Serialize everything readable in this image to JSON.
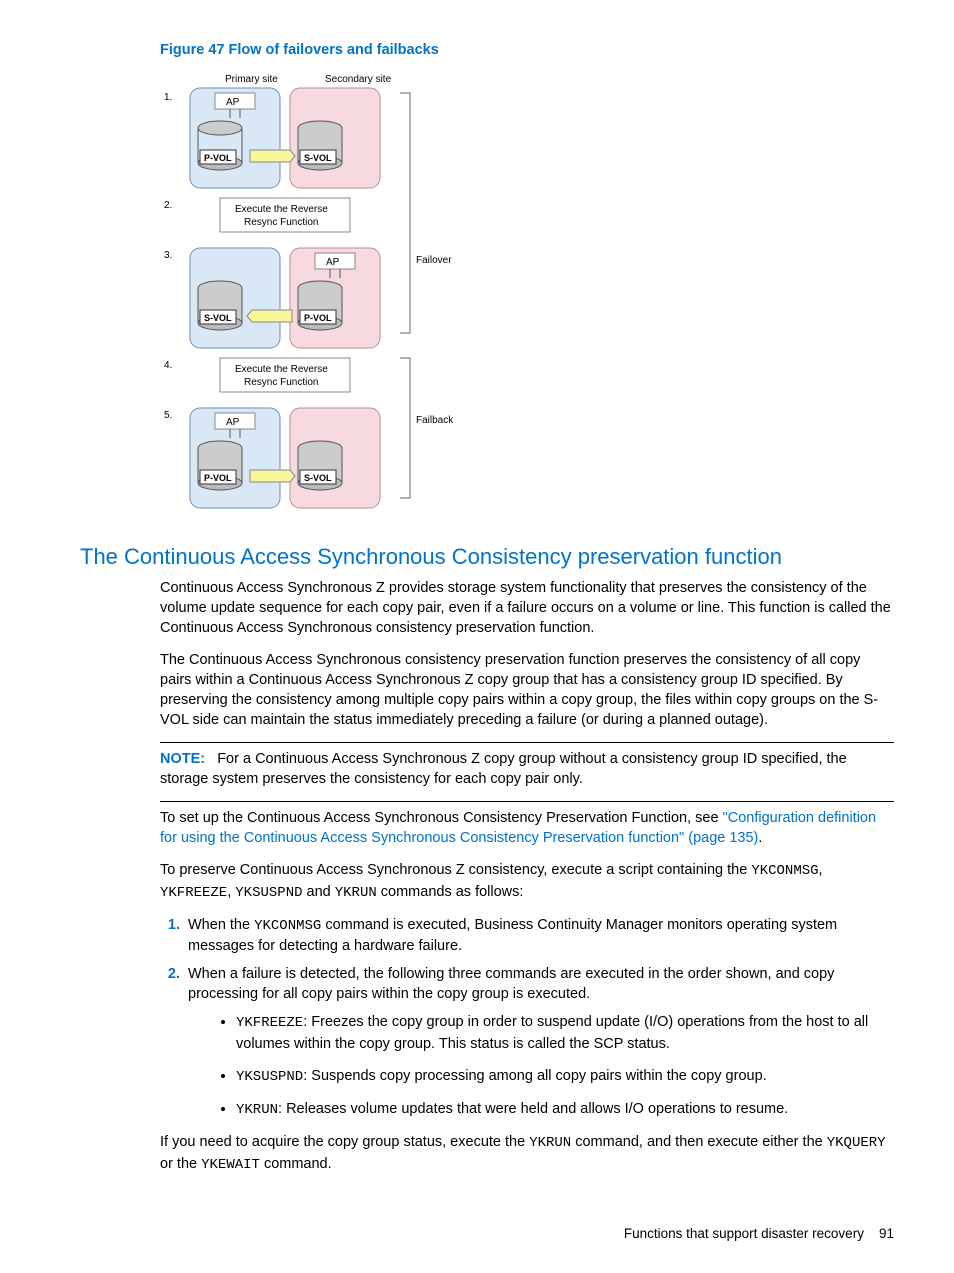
{
  "figure": {
    "caption": "Figure 47 Flow of failovers and failbacks",
    "primary_label": "Primary site",
    "secondary_label": "Secondary site",
    "ap": "AP",
    "pvol": "P-VOL",
    "svol": "S-VOL",
    "reverse_resync": "Execute the Reverse Resync Function",
    "failover": "Failover",
    "failback": "Failback",
    "steps": [
      "1.",
      "2.",
      "3.",
      "4.",
      "5."
    ]
  },
  "section_heading": "The Continuous Access Synchronous Consistency preservation function",
  "para1": "Continuous Access Synchronous Z provides storage system functionality that preserves the consistency of the volume update sequence for each copy pair, even if a failure occurs on a volume or line. This function is called the Continuous Access Synchronous consistency preservation function.",
  "para2": "The Continuous Access Synchronous consistency preservation function preserves the consistency of all copy pairs within a Continuous Access Synchronous Z copy group that has a consistency group ID specified. By preserving the consistency among multiple copy pairs within a copy group, the files within copy groups on the S-VOL side can maintain the status immediately preceding a failure (or during a planned outage).",
  "note": {
    "label": "NOTE:",
    "text": "For a Continuous Access Synchronous Z copy group without a consistency group ID specified, the storage system preserves the consistency for each copy pair only."
  },
  "para3_a": "To set up the Continuous Access Synchronous Consistency Preservation Function, see ",
  "para3_link": "\"Configuration definition for using the Continuous Access Synchronous Consistency Preservation function\" (page 135)",
  "para3_b": ".",
  "para4_a": "To preserve Continuous Access Synchronous Z consistency, execute a script containing the ",
  "para4_b": ", ",
  "para4_c": ", ",
  "para4_d": " and ",
  "para4_e": " commands as follows:",
  "cmds": {
    "conmsg": "YKCONMSG",
    "freeze": "YKFREEZE",
    "suspnd": "YKSUSPND",
    "run": "YKRUN",
    "query": "YKQUERY",
    "ewait": "YKEWAIT"
  },
  "step1_a": "When the ",
  "step1_b": " command is executed, Business Continuity Manager monitors operating system messages for detecting a hardware failure.",
  "step2": "When a failure is detected, the following three commands are executed in the order shown, and copy processing for all copy pairs within the copy group is executed.",
  "sub1": ": Freezes the copy group in order to suspend update (I/O) operations from the host to all volumes within the copy group. This status is called the SCP status.",
  "sub2": ": Suspends copy processing among all copy pairs within the copy group.",
  "sub3": ": Releases volume updates that were held and allows I/O operations to resume.",
  "para5_a": "If you need to acquire the copy group status, execute the ",
  "para5_b": " command, and then execute either the ",
  "para5_c": " or the ",
  "para5_d": " command.",
  "footer_text": "Functions that support disaster recovery",
  "page_number": "91"
}
